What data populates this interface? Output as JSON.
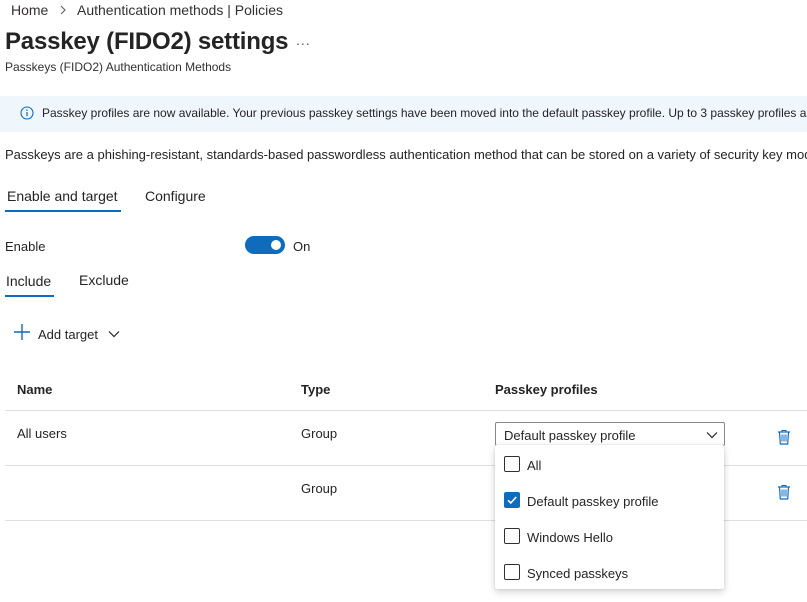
{
  "breadcrumb": {
    "home": "Home",
    "parent": "Authentication methods | Policies",
    "separator": ">"
  },
  "header": {
    "title": "Passkey (FIDO2) settings",
    "more_glyph": "...",
    "subtitle": "Passkeys (FIDO2) Authentication Methods"
  },
  "banner": {
    "text": "Passkey profiles are now available. Your previous passkey settings have been moved into the default passkey profile. Up to 3 passkey profiles are",
    "icon": "info-icon"
  },
  "description": "Passkeys are a phishing-resistant, standards-based passwordless authentication method that can be stored on a variety of security key mode",
  "tabs": [
    {
      "label": "Enable and target",
      "selected": true
    },
    {
      "label": "Configure",
      "selected": false
    }
  ],
  "enable": {
    "label": "Enable",
    "state_label": "On",
    "on": true
  },
  "subtabs": [
    {
      "label": "Include",
      "selected": true
    },
    {
      "label": "Exclude",
      "selected": false
    }
  ],
  "add_target": {
    "label": "Add target",
    "icon": "plus-icon"
  },
  "table": {
    "columns": [
      "Name",
      "Type",
      "Passkey profiles"
    ],
    "rows": [
      {
        "name": "All users",
        "type": "Group"
      },
      {
        "name": "",
        "type": "Group"
      }
    ]
  },
  "profile_select": {
    "value": "Default passkey profile"
  },
  "profile_options": [
    {
      "label": "All",
      "checked": false
    },
    {
      "label": "Default passkey profile",
      "checked": true
    },
    {
      "label": "Windows Hello",
      "checked": false
    },
    {
      "label": "Synced passkeys",
      "checked": false
    }
  ],
  "colors": {
    "accent": "#0f6cbd",
    "banner_bg": "#eff6fc",
    "trash": "#0f6cbd"
  }
}
